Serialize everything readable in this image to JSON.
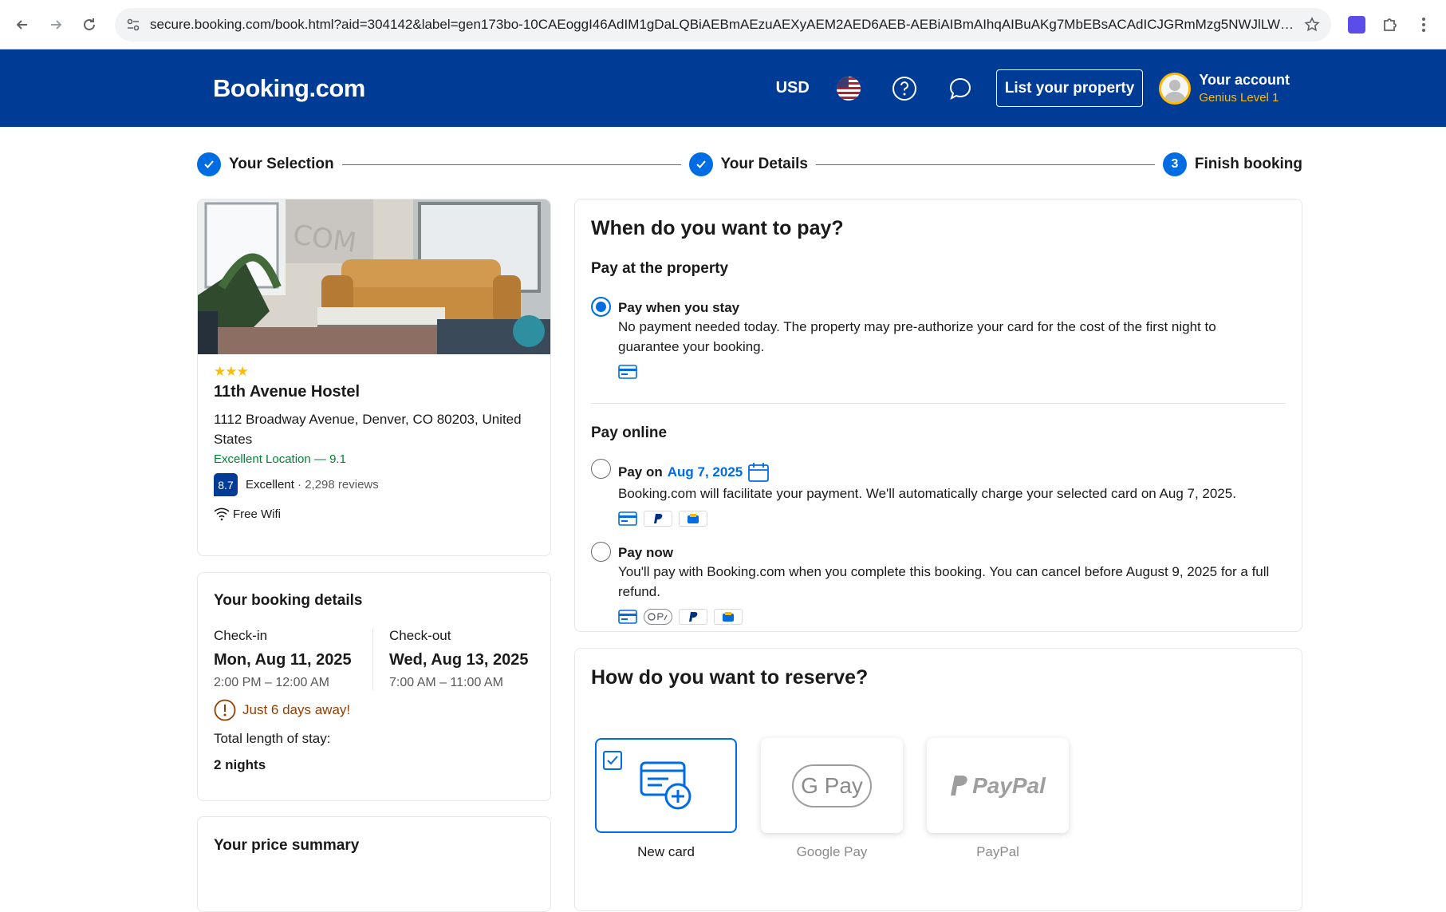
{
  "browser": {
    "url": "secure.booking.com/book.html?aid=304142&label=gen173bo-10CAEoggI46AdIM1gDaLQBiAEBmAEzuAEXyAEM2AED6AEB-AEBiAIBmAIhqAIBuAKg7MbEBsACAdICJGRmMzg5NWJlLWYw..."
  },
  "header": {
    "logo": "Booking.com",
    "currency": "USD",
    "list_property": "List your property",
    "account_name": "Your account",
    "account_level": "Genius Level 1"
  },
  "steps": [
    {
      "label": "Your Selection",
      "state": "done"
    },
    {
      "label": "Your Details",
      "state": "done"
    },
    {
      "label": "Finish booking",
      "state": "current",
      "number": "3"
    }
  ],
  "hotel": {
    "stars": "★★★",
    "name": "11th Avenue Hostel",
    "address": "1112 Broadway Avenue, Denver, CO 80203, United States",
    "location_score": "Excellent Location — 9.1",
    "score": "8.7",
    "score_word": "Excellent",
    "reviews": "· 2,298 reviews",
    "amenity": "Free Wifi"
  },
  "booking_details": {
    "title": "Your booking details",
    "checkin_label": "Check-in",
    "checkin_date": "Mon, Aug 11, 2025",
    "checkin_time": "2:00 PM – 12:00 AM",
    "checkout_label": "Check-out",
    "checkout_date": "Wed, Aug 13, 2025",
    "checkout_time": "7:00 AM – 11:00 AM",
    "urgency": "Just 6 days away!",
    "length_label": "Total length of stay:",
    "length_value": "2 nights"
  },
  "price_summary": {
    "title": "Your price summary"
  },
  "payment": {
    "title": "When do you want to pay?",
    "section_property": "Pay at the property",
    "opt1_title": "Pay when you stay",
    "opt1_desc": "No payment needed today. The property may pre-authorize your card for the cost of the first night to guarantee your booking.",
    "section_online": "Pay online",
    "opt2_prefix": "Pay on",
    "opt2_date": "Aug 7, 2025",
    "opt2_desc": "Booking.com will facilitate your payment. We'll automatically charge your selected card on Aug 7, 2025.",
    "opt3_title": "Pay now",
    "opt3_desc": "You'll pay with Booking.com when you complete this booking. You can cancel before August 9, 2025 for a full refund.",
    "selected": "Pay when you stay"
  },
  "reserve": {
    "title": "How do you want to reserve?",
    "options": [
      {
        "label": "New card",
        "selected": true
      },
      {
        "label": "Google Pay",
        "selected": false
      },
      {
        "label": "PayPal",
        "selected": false
      }
    ],
    "gpay_text": "G Pay",
    "paypal_text": "PayPal"
  },
  "colors": {
    "brand": "#003b95",
    "accent": "#006ce4",
    "genius": "#febb02",
    "positive": "#008234",
    "urgency": "#923e01"
  }
}
